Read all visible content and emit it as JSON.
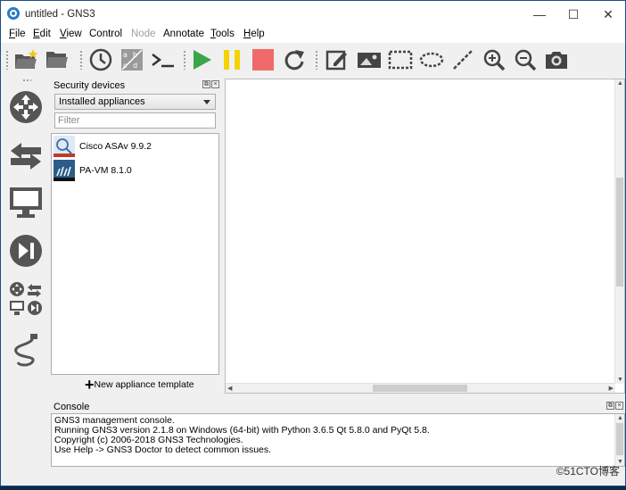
{
  "window": {
    "title": "untitled - GNS3",
    "minimize_glyph": "—",
    "maximize_glyph": "☐",
    "close_glyph": "✕"
  },
  "menu": [
    {
      "label": "File",
      "underline": "F",
      "rest": "ile"
    },
    {
      "label": "Edit",
      "underline": "E",
      "rest": "dit"
    },
    {
      "label": "View",
      "underline": "V",
      "rest": "iew"
    },
    {
      "label": "Control",
      "underline": "",
      "rest": "Control"
    },
    {
      "label": "Node",
      "underline": "",
      "rest": "Node",
      "disabled": true
    },
    {
      "label": "Annotate",
      "underline": "",
      "rest": "Annotate"
    },
    {
      "label": "Tools",
      "underline": "T",
      "rest": "ools"
    },
    {
      "label": "Help",
      "underline": "H",
      "rest": "elp"
    }
  ],
  "toolbar": {
    "icons": [
      "open-project-icon",
      "open-folder-icon",
      "snapshot-clock-icon",
      "show-interface-labels-icon",
      "console-all-icon",
      "start-all-icon",
      "suspend-all-icon",
      "stop-all-icon",
      "reload-all-icon",
      "add-note-icon",
      "insert-image-icon",
      "draw-rectangle-icon",
      "draw-ellipse-icon",
      "draw-line-icon",
      "zoom-in-icon",
      "zoom-out-icon",
      "screenshot-icon"
    ],
    "colors": {
      "start": "#3aa64a",
      "suspend": "#f5d200",
      "stop": "#f06a6a"
    }
  },
  "left_toolbar": {
    "icons": [
      "routers-icon",
      "switches-icon",
      "end-devices-icon",
      "security-devices-icon",
      "all-devices-icon",
      "add-link-icon"
    ]
  },
  "devices_dock": {
    "title": "Security devices",
    "dropdown_value": "Installed appliances",
    "filter_placeholder": "Filter",
    "items": [
      {
        "label": "Cisco ASAv 9.9.2",
        "icon": "cisco-asav-icon"
      },
      {
        "label": "PA-VM 8.1.0",
        "icon": "pa-vm-icon"
      }
    ],
    "new_template_label": "New appliance template"
  },
  "console": {
    "title": "Console",
    "lines": [
      "GNS3 management console.",
      "Running GNS3 version 2.1.8 on Windows (64-bit) with Python 3.6.5 Qt 5.8.0 and PyQt 5.8.",
      "Copyright (c) 2006-2018 GNS3 Technologies.",
      "Use Help -> GNS3 Doctor to detect common issues."
    ]
  },
  "watermark": "©51CTO博客"
}
